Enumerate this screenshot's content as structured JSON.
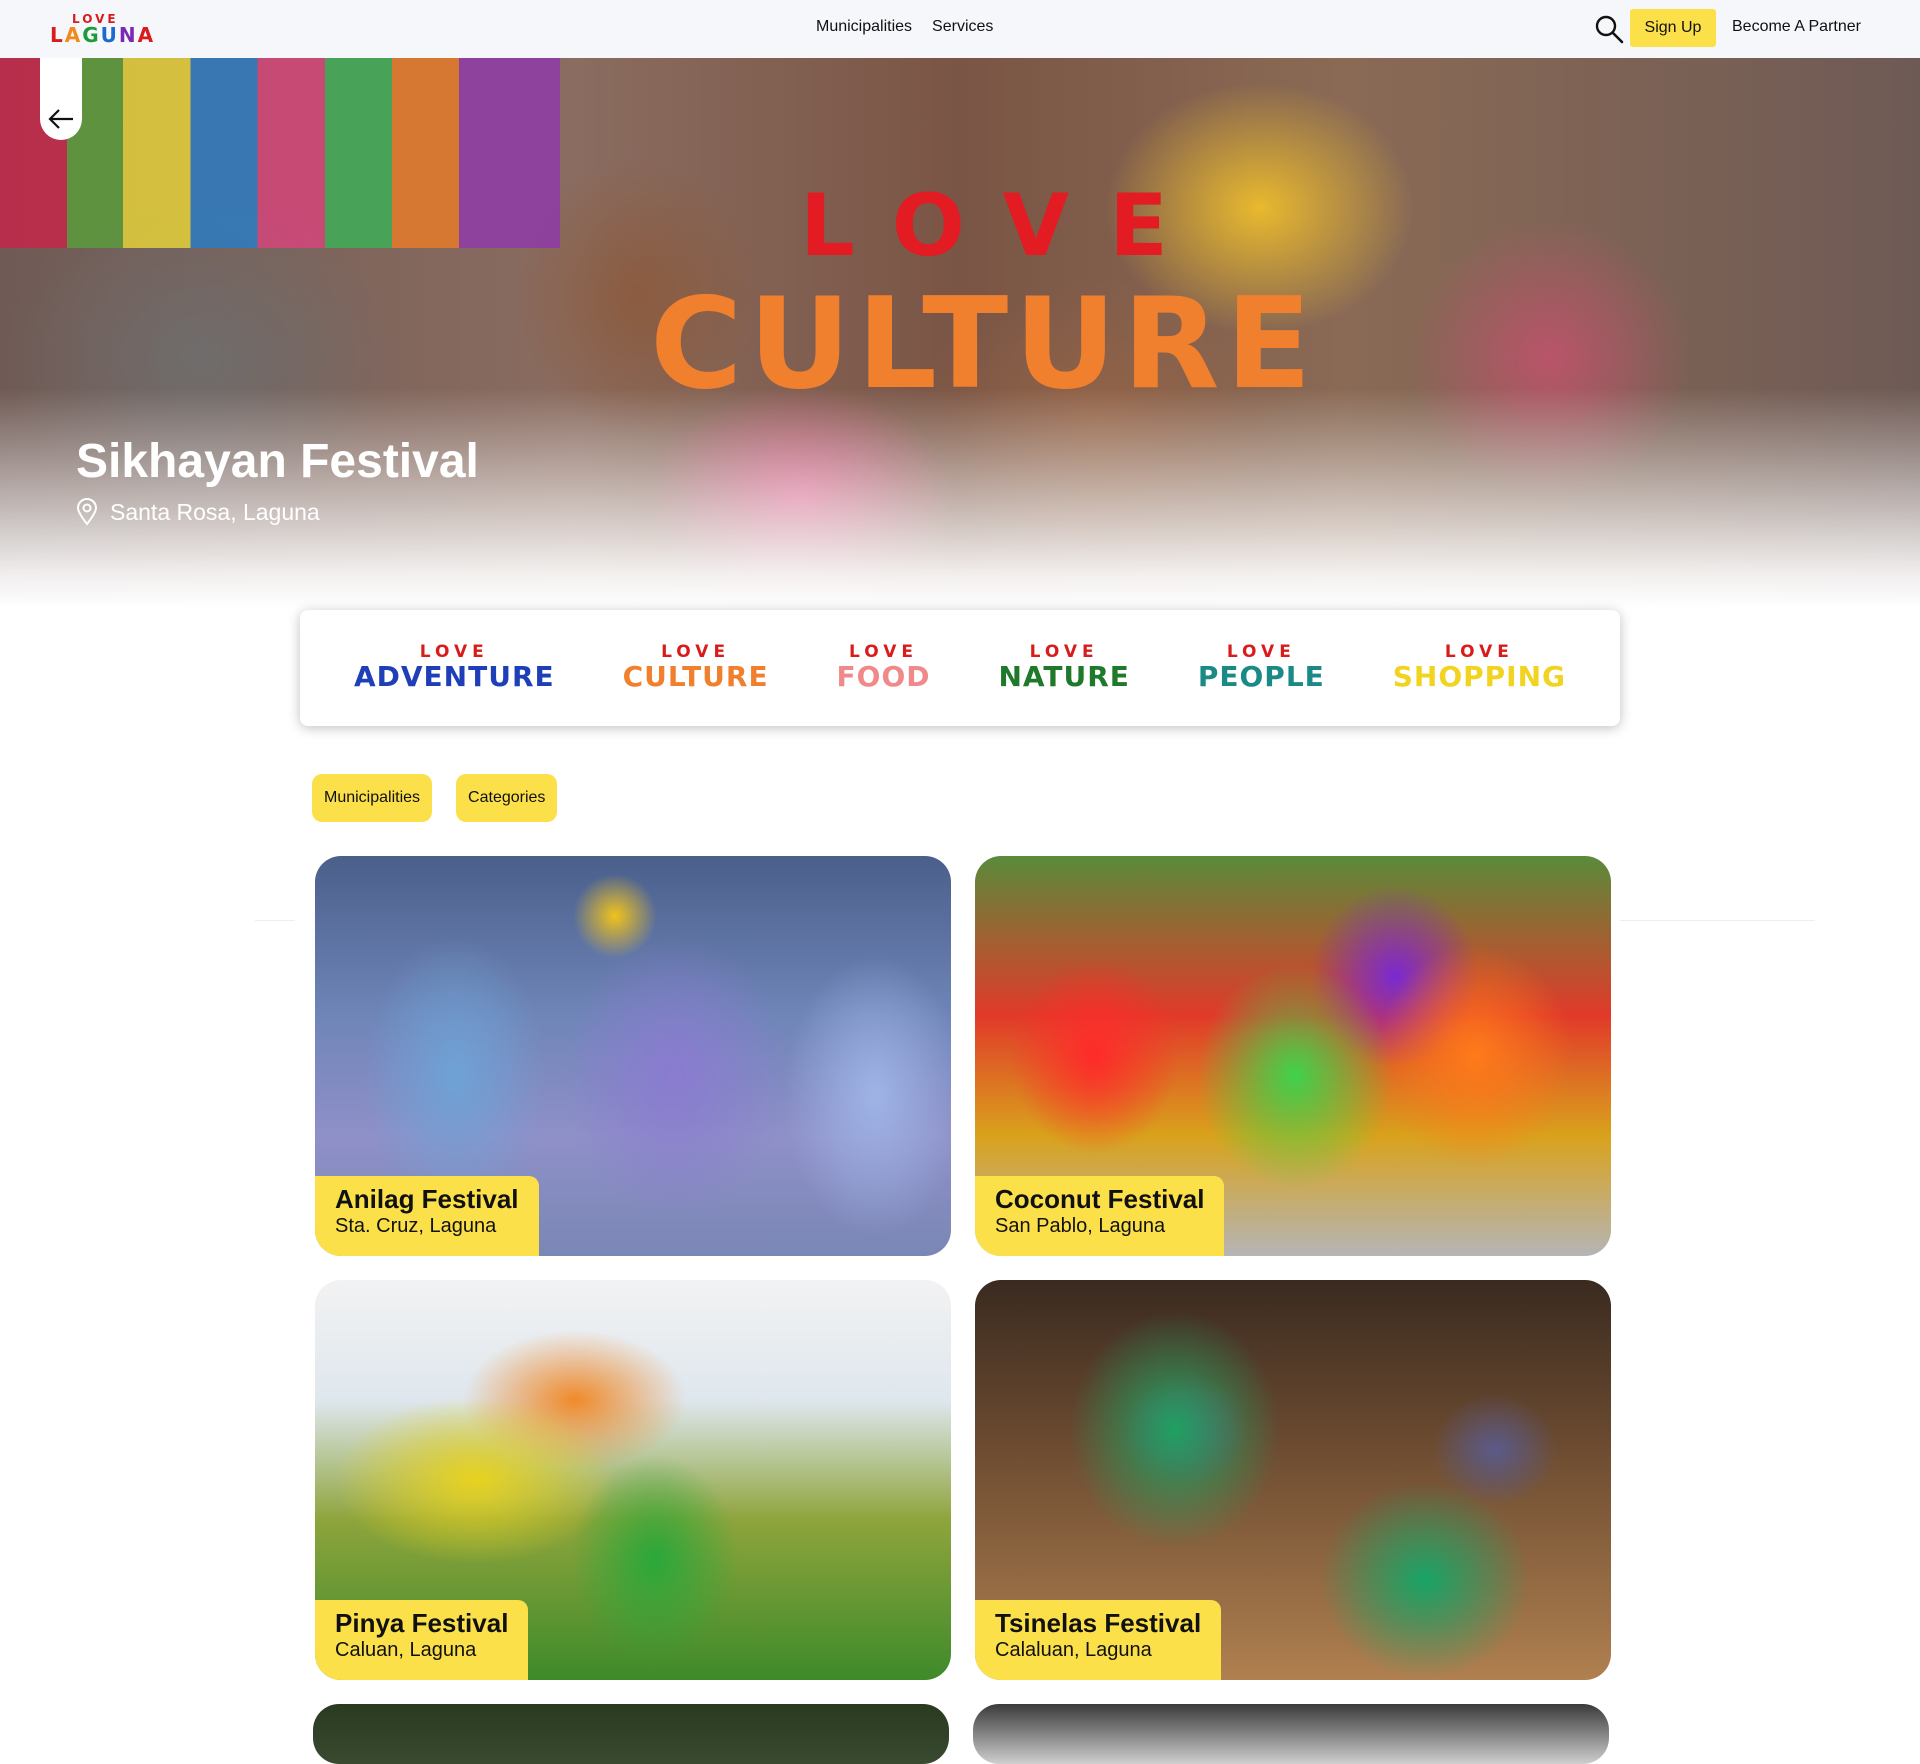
{
  "header": {
    "logo_love": "LOVE",
    "logo_word": "LAGUNA",
    "nav": [
      "Municipalities",
      "Services"
    ],
    "signup_label": "Sign Up",
    "partner_label": "Become A Partner"
  },
  "hero": {
    "love": "LOVE",
    "category": "CULTURE",
    "title": "Sikhayan Festival",
    "location": "Santa Rosa, Laguna"
  },
  "categories": [
    {
      "love": "LOVE",
      "word": "ADVENTURE",
      "color": "#1f3fb8"
    },
    {
      "love": "LOVE",
      "word": "CULTURE",
      "color": "#f07f2e"
    },
    {
      "love": "LOVE",
      "word": "FOOD",
      "color": "#f08a8a"
    },
    {
      "love": "LOVE",
      "word": "NATURE",
      "color": "#1e7a2a"
    },
    {
      "love": "LOVE",
      "word": "PEOPLE",
      "color": "#1a8a86"
    },
    {
      "love": "LOVE",
      "word": "SHOPPING",
      "color": "#f1d320"
    }
  ],
  "filters": {
    "municipalities": "Municipalities",
    "categories": "Categories"
  },
  "cards": [
    {
      "name": "Anilag Festival",
      "place": "Sta. Cruz, Laguna"
    },
    {
      "name": "Coconut Festival",
      "place": "San Pablo, Laguna"
    },
    {
      "name": "Pinya Festival",
      "place": "Caluan, Laguna"
    },
    {
      "name": "Tsinelas Festival",
      "place": "Calaluan, Laguna"
    }
  ],
  "colors": {
    "accent_yellow": "#fbe04a",
    "love_red": "#e31b23",
    "culture_orange": "#f07f2e"
  }
}
